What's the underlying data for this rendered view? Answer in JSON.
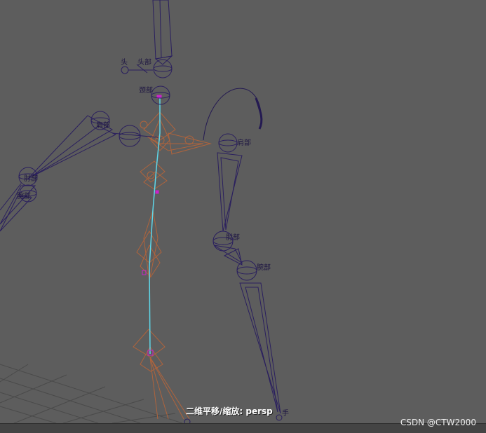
{
  "viewport": {
    "camera_label": "二维平移/缩放: persp",
    "watermark": "CSDN @CTW2000"
  },
  "labels": {
    "head": "头",
    "head_top": "头部",
    "neck": "颈部",
    "left_shoulder": "肩部",
    "left_elbow": "肘部",
    "left_wrist": "腕部",
    "right_shoulder": "肩部",
    "right_elbow": "肘部",
    "right_wrist": "腕部",
    "right_hand": "手"
  },
  "colors": {
    "background": "#5d5d5d",
    "grid": "#4a4a4a",
    "skeleton_purple": "#2a1f5e",
    "skeleton_orange": "#b0643c",
    "selected_joint": "#5ed8ea",
    "joint_marker": "#cc22cc"
  }
}
